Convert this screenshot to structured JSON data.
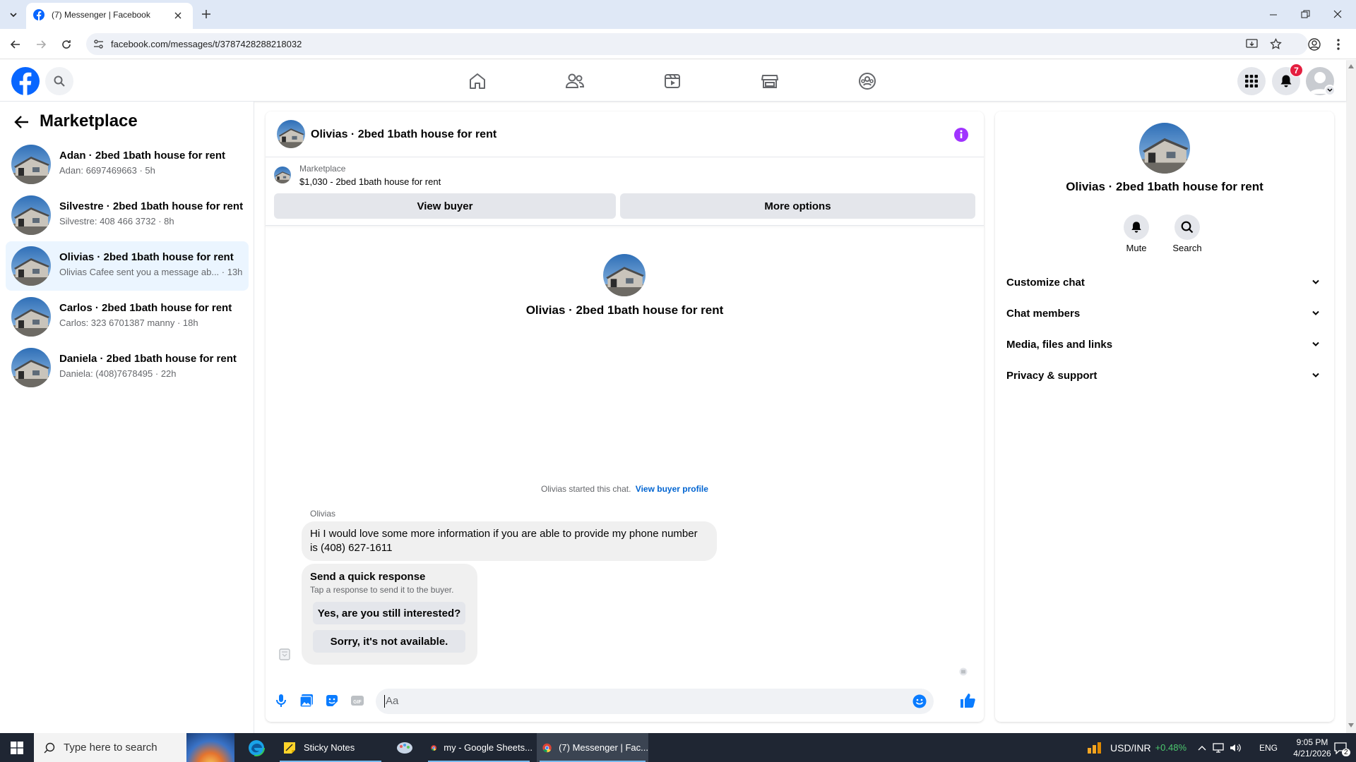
{
  "browser": {
    "tab_title": "(7) Messenger | Facebook",
    "url": "facebook.com/messages/t/3787428288218032"
  },
  "header": {
    "notification_count": "7",
    "nav_items": [
      "home-icon",
      "friends-icon",
      "watch-icon",
      "marketplace-icon",
      "groups-icon"
    ]
  },
  "sidebar": {
    "title": "Marketplace",
    "conversations": [
      {
        "name": "Adan · 2bed 1bath house for rent",
        "snippet": "Adan: 6697469663 · 5h",
        "active": false
      },
      {
        "name": "Silvestre · 2bed 1bath house for rent",
        "snippet": "Silvestre: 408 466 3732 · 8h",
        "active": false
      },
      {
        "name": "Olivias · 2bed 1bath house for rent",
        "snippet": "Olivias Cafee sent you a message ab... · 13h",
        "active": true
      },
      {
        "name": "Carlos · 2bed 1bath house for rent",
        "snippet": "Carlos: 323 6701387 manny · 18h",
        "active": false
      },
      {
        "name": "Daniela · 2bed 1bath house for rent",
        "snippet": "Daniela: (408)7678495 · 22h",
        "active": false
      }
    ]
  },
  "chat": {
    "title": "Olivias · 2bed 1bath house for rent",
    "listing_source": "Marketplace",
    "listing_detail": "$1,030 - 2bed 1bath house for rent",
    "view_buyer": "View buyer",
    "more_options": "More options",
    "intro_name": "Olivias · 2bed 1bath house for rent",
    "started_text": "Olivias started this chat.",
    "view_buyer_profile": "View buyer profile",
    "sender": "Olivias",
    "message_line1": "Hi I would love some more information if you are able to provide my phone number",
    "message_line2": "is (408) 627-1611",
    "quick_title": "Send a quick response",
    "quick_subtitle": "Tap a response to send it to the buyer.",
    "quick_options": [
      "Yes, are you still interested?",
      "Sorry, it's not available."
    ],
    "composer_placeholder": "Aa"
  },
  "details": {
    "name": "Olivias · 2bed 1bath house for rent",
    "mute_label": "Mute",
    "search_label": "Search",
    "sections": [
      "Customize chat",
      "Chat members",
      "Media, files and links",
      "Privacy & support"
    ]
  },
  "taskbar": {
    "search_placeholder": "Type here to search",
    "apps": [
      "Sticky Notes",
      "my - Google Sheets...",
      "(7) Messenger | Fac..."
    ],
    "ticker_label": "USD/INR",
    "ticker_change": "+0.48%",
    "language": "ENG",
    "time": "9:05 PM",
    "date": "4/21/2026",
    "notif_count": "2"
  },
  "colors": {
    "fb_blue": "#0866ff",
    "messenger_accent": "#0a7cff",
    "badge_red": "#e41e3f",
    "info_purple": "#a033ff",
    "ticker_green": "#4cc86e"
  }
}
